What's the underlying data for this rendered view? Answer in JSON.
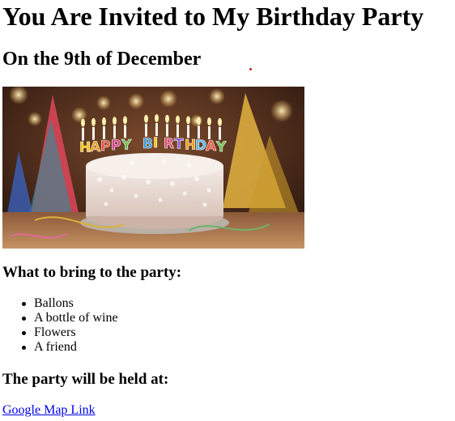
{
  "page": {
    "title": "You Are Invited to My Birthday Party",
    "subtitle": "On the 9th of December"
  },
  "image": {
    "banner_text": "HAPPY BIRTHDAY",
    "letter_colors": [
      "#f7c400",
      "#f29b17",
      "#ea4f3b",
      "#d83f8c",
      "#6ac04a",
      "#3a9ad9",
      "#f7c400",
      "#e84b7a",
      "#8e5bd6",
      "#f29b17",
      "#56b8e8",
      "#ea4f3b",
      "#6ac04a",
      "#f7c400"
    ]
  },
  "bring": {
    "heading": "What to bring to the party:",
    "items": [
      "Ballons",
      "A bottle of wine",
      "Flowers",
      "A friend"
    ]
  },
  "location": {
    "heading": "The party will be held at:",
    "link_text": "Google Map Link"
  },
  "colors": {
    "text": "#000000",
    "link": "#0000ee",
    "background": "#ffffff"
  }
}
